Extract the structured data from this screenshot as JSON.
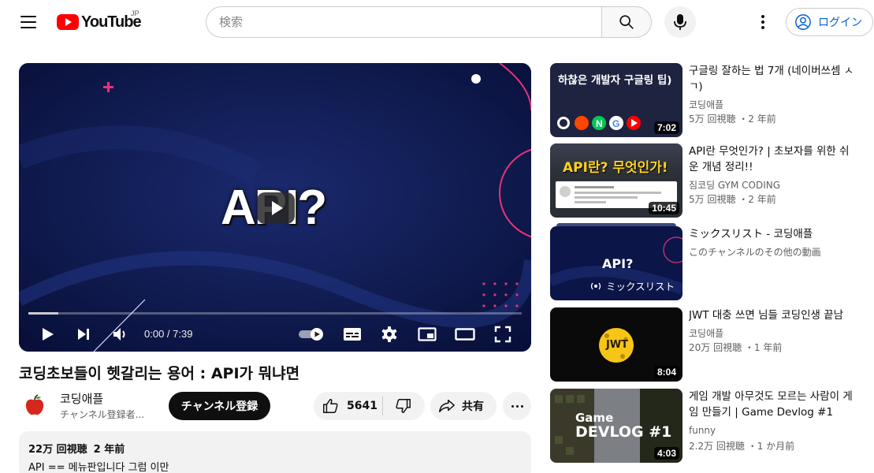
{
  "header": {
    "logo_text": "YouTube",
    "region": "JP",
    "search_placeholder": "検索",
    "login_label": "ログイン"
  },
  "player": {
    "overlay_text": "API?",
    "current_time": "0:00",
    "duration": "7:39",
    "time_display": "0:00 / 7:39",
    "progress": 0.06
  },
  "video": {
    "title": "코딩초보들이 헷갈리는 용어 : API가 뭐냐면",
    "channel_name": "코딩애플",
    "channel_subscribers": "チャンネル登録者...",
    "subscribe_label": "チャンネル登録",
    "likes": "5641",
    "share_label": "共有",
    "views": "22万 回視聴",
    "published": "2 年前",
    "description": "API == 메뉴판입니다 그럼 이만"
  },
  "recommendations": [
    {
      "title": "구글링 잘하는 법 7개 (네이버쓰셈 ㅅㄱ)",
      "channel": "코딩애플",
      "meta": "5万 回視聴 ・2 年前",
      "duration": "7:02",
      "thumb_text": "하찮은 개발자 구글링 팁)"
    },
    {
      "title": "API란 무엇인가? | 초보자를 위한 쉬운 개념 정리!!",
      "channel": "짐코딩 GYM CODING",
      "meta": "5万 回視聴 ・2 年前",
      "duration": "10:45",
      "thumb_text": "API란? 무엇인가!"
    },
    {
      "title": "ミックスリスト - 코딩애플",
      "channel": "このチャンネルのその他の動画",
      "meta": "",
      "duration": "",
      "thumb_text": "API?",
      "mix_label": "ミックスリスト"
    },
    {
      "title": "JWT 대충 쓰면 님들 코딩인생 끝남",
      "channel": "코딩애플",
      "meta": "20万 回視聴 ・1 年前",
      "duration": "8:04",
      "thumb_text": "JWT"
    },
    {
      "title": "게임 개발 아무것도 모르는 사람이 게임 만들기 | Game Devlog #1",
      "channel": "funny",
      "meta": "2.2万 回視聴 ・1 か月前",
      "duration": "4:03",
      "thumb_text": "Game",
      "thumb_text2": "DEVLOG #1"
    }
  ],
  "colors": {
    "brand_red": "#ff0000",
    "link_blue": "#065fd4",
    "player_bg": "#0a1240",
    "accent_pink": "#e6337a"
  }
}
